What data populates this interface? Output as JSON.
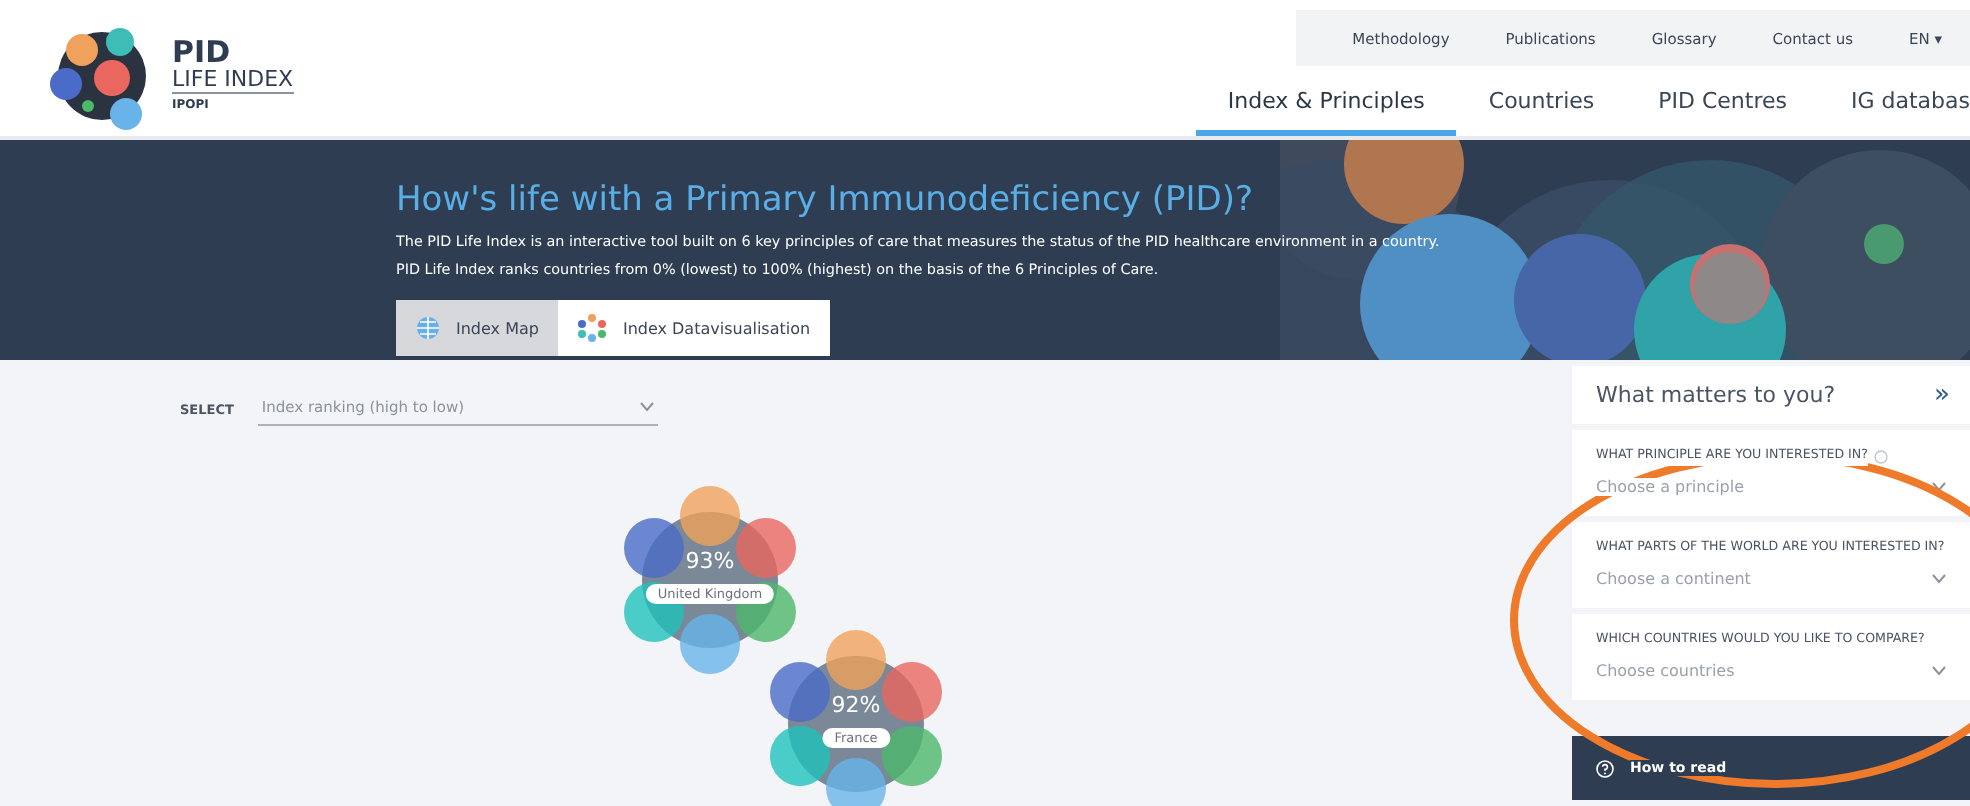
{
  "logo": {
    "title": "PID",
    "subtitle": "LIFE INDEX",
    "org": "IPOPI"
  },
  "utility_nav": [
    {
      "label": "Methodology"
    },
    {
      "label": "Publications"
    },
    {
      "label": "Glossary"
    },
    {
      "label": "Contact us"
    },
    {
      "label": "EN ▾"
    }
  ],
  "main_nav": [
    {
      "label": "Index & Principles",
      "selected": true
    },
    {
      "label": "Countries",
      "selected": false
    },
    {
      "label": "PID Centres",
      "selected": false
    },
    {
      "label": "IG databas",
      "selected": false
    }
  ],
  "hero": {
    "title": "How's life with a Primary Immunodeficiency (PID)?",
    "lines": [
      "The PID Life Index is an interactive tool built on 6 key principles of care that measures the status of the PID healthcare environment in a country.",
      "PID Life Index ranks countries from 0% (lowest) to 100% (highest) on the basis of the 6 Principles of Care."
    ]
  },
  "view_tabs": [
    {
      "label": "Index Map",
      "selected": false
    },
    {
      "label": "Index Datavisualisation",
      "selected": true
    }
  ],
  "select": {
    "label": "SELECT",
    "value": "Index ranking (high to low)"
  },
  "countries": [
    {
      "score": "93%",
      "name": "United Kingdom"
    },
    {
      "score": "92%",
      "name": "France"
    }
  ],
  "panel": {
    "title": "What matters to you?",
    "collapse": "»",
    "filters": [
      {
        "question": "WHAT PRINCIPLE ARE YOU INTERESTED IN?",
        "help": true,
        "placeholder": "Choose a principle"
      },
      {
        "question": "WHAT PARTS OF THE WORLD ARE YOU INTERESTED IN?",
        "help": false,
        "placeholder": "Choose a continent"
      },
      {
        "question": "WHICH COUNTRIES WOULD YOU LIKE TO COMPARE?",
        "help": false,
        "placeholder": "Choose countries"
      }
    ],
    "how_to_read": "How to read"
  }
}
